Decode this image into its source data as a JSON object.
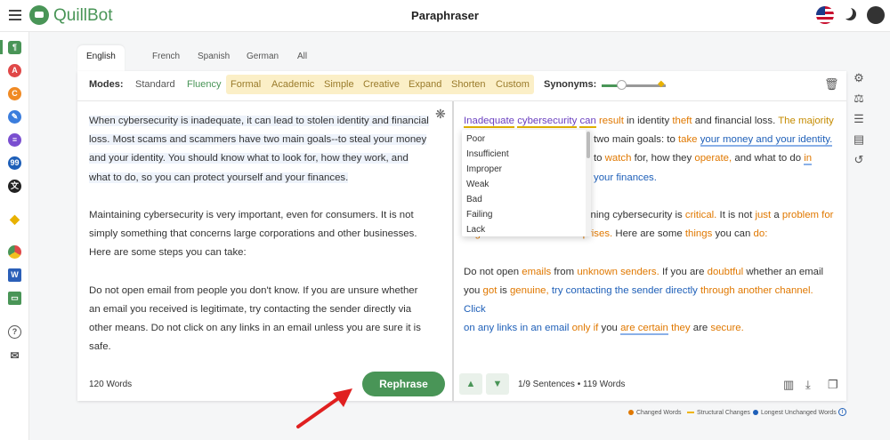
{
  "header": {
    "brand": "QuillBot",
    "title": "Paraphraser"
  },
  "languages": [
    "English (US)",
    "French",
    "Spanish",
    "German",
    "All"
  ],
  "modes": {
    "label": "Modes:",
    "items": [
      "Standard",
      "Fluency",
      "Formal",
      "Academic",
      "Simple",
      "Creative",
      "Expand",
      "Shorten",
      "Custom"
    ],
    "active": "Fluency"
  },
  "synonyms": {
    "label": "Synonyms:",
    "level": 0.3
  },
  "input": {
    "paragraphs": [
      "When cybersecurity is inadequate, it can lead to stolen identity and financial loss. Most scams and scammers have two main goals--to steal your money and your identity. You should know what to look for, how they work, and what to do, so you can protect yourself and your finances.",
      "Maintaining cybersecurity is very important, even for consumers. It is not simply something that concerns large corporations and other businesses. Here are some steps you can take:",
      "Do not open email from people you don't know. If you are unsure whether an email you received is legitimate, try contacting the sender directly via other means. Do not click on any links in an email unless you are sure it is safe."
    ],
    "word_count": "120 Words",
    "rephrase_label": "Rephrase"
  },
  "output": {
    "p1": {
      "w1": "Inadequate",
      "w2": "cybersecurity",
      "w3": "can",
      "w4": "result",
      "w5": "in identity",
      "w6": "theft",
      "w7": "and financial loss.",
      "w8": "The majority",
      "w9": "two main goals: to",
      "w10": "take",
      "w11": "your money and your identity.",
      "w12": "to",
      "w13": "watch",
      "w14": "for, how they",
      "w15": "operate,",
      "w16": "and what to do",
      "w17": "in",
      "w18": "your finances."
    },
    "p2": {
      "w1": "ining cybersecurity is",
      "w2": "critical.",
      "w3": "It is not",
      "w4": "just",
      "w5": "a",
      "w6": "problem for",
      "w7": "huge firms",
      "w8": "and other",
      "w9": "enterprises.",
      "w10": "Here are some",
      "w11": "things",
      "w12": "you can",
      "w13": "do:"
    },
    "p3": {
      "w1": "Do not open",
      "w2": "emails",
      "w3": "from",
      "w4": "unknown senders.",
      "w5": "If you are",
      "w6": "doubtful",
      "w7": "whether an email",
      "w8": "you",
      "w9": "got",
      "w10": "is",
      "w11": "genuine,",
      "w12": "try contacting the sender directly",
      "w13": "through another channel.",
      "w14": "Click",
      "w15": "on any links in an email",
      "w16": "only if",
      "w17": "you",
      "w18": "are certain",
      "w19": "they",
      "w20": "are",
      "w21": "secure."
    },
    "sentence_info": "1/9 Sentences",
    "word_count": "119 Words"
  },
  "synonym_dropdown": [
    "Poor",
    "Insufficient",
    "Improper",
    "Weak",
    "Bad",
    "Failing",
    "Lack"
  ],
  "legend": {
    "changed": "Changed Words",
    "structural": "Structural Changes",
    "unchanged": "Longest Unchanged Words"
  },
  "colors": {
    "brand": "#499557",
    "changed": "#e07800",
    "structural": "#f0b400",
    "unchanged": "#1e5fb8"
  }
}
